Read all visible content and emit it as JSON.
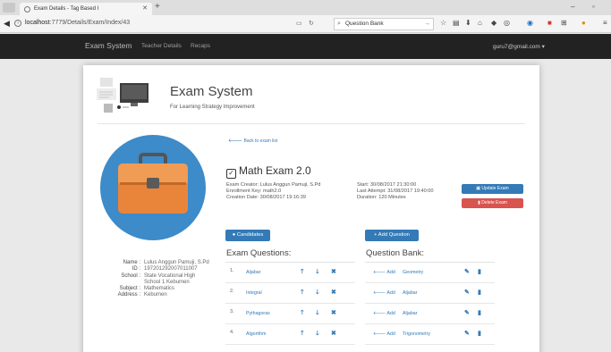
{
  "browser": {
    "tab_title": "Exam Details - Tag Based I",
    "url_host": "localhost",
    "url_path": ":7779/Details/Exam/Index/43",
    "search_value": "Question Bank"
  },
  "navbar": {
    "brand": "Exam System",
    "links": [
      "Teacher Details",
      "Recaps"
    ],
    "user": "guru7@gmail.com"
  },
  "header": {
    "title": "Exam System",
    "subtitle": "For Learning Strategy Improvement"
  },
  "profile": [
    {
      "key": "Name :",
      "value": "Lulus Anggun Pamuji, S.Pd"
    },
    {
      "key": "ID :",
      "value": "197201292007011007"
    },
    {
      "key": "School :",
      "value": "State Vocational High School 1 Kebumen"
    },
    {
      "key": "Subject :",
      "value": "Mathematics"
    },
    {
      "key": "Address :",
      "value": "Kebumen"
    }
  ],
  "exam": {
    "back_link": "Back to exam list",
    "title": "Math Exam 2.0",
    "creator": "Exam Creator: Lulus Anggun Pamuji, S.Pd",
    "enrollment_key": "Enrollment Key: math2.0",
    "creation_date": "Creation Date: 30/08/2017 19:16:39",
    "start": "Start: 30/08/2017 21:30:00",
    "last_attempt": "Last Attempt: 31/08/2017 19:40:00",
    "duration": "Duration: 120 Minutes",
    "update_label": "Update Exam",
    "delete_label": "Delete Exam"
  },
  "candidates_label": "Candidates",
  "add_question_label": "+ Add Question",
  "exam_questions": {
    "heading": "Exam Questions:",
    "items": [
      {
        "num": "1.",
        "name": "Aljabar"
      },
      {
        "num": "2.",
        "name": "Integral"
      },
      {
        "num": "3.",
        "name": "Pythagoras"
      },
      {
        "num": "4.",
        "name": "Algorithm"
      }
    ]
  },
  "question_bank": {
    "heading": "Question Bank:",
    "add_label": "Add",
    "items": [
      {
        "name": "Geometry"
      },
      {
        "name": "Aljabar"
      },
      {
        "name": "Aljabar"
      },
      {
        "name": "Trigonometry"
      }
    ]
  },
  "colors": {
    "navbar": "#222222",
    "primary": "#337ab7",
    "danger": "#d9534f",
    "avatar_bg": "#3d8bc9",
    "briefcase": "#e8853b"
  }
}
